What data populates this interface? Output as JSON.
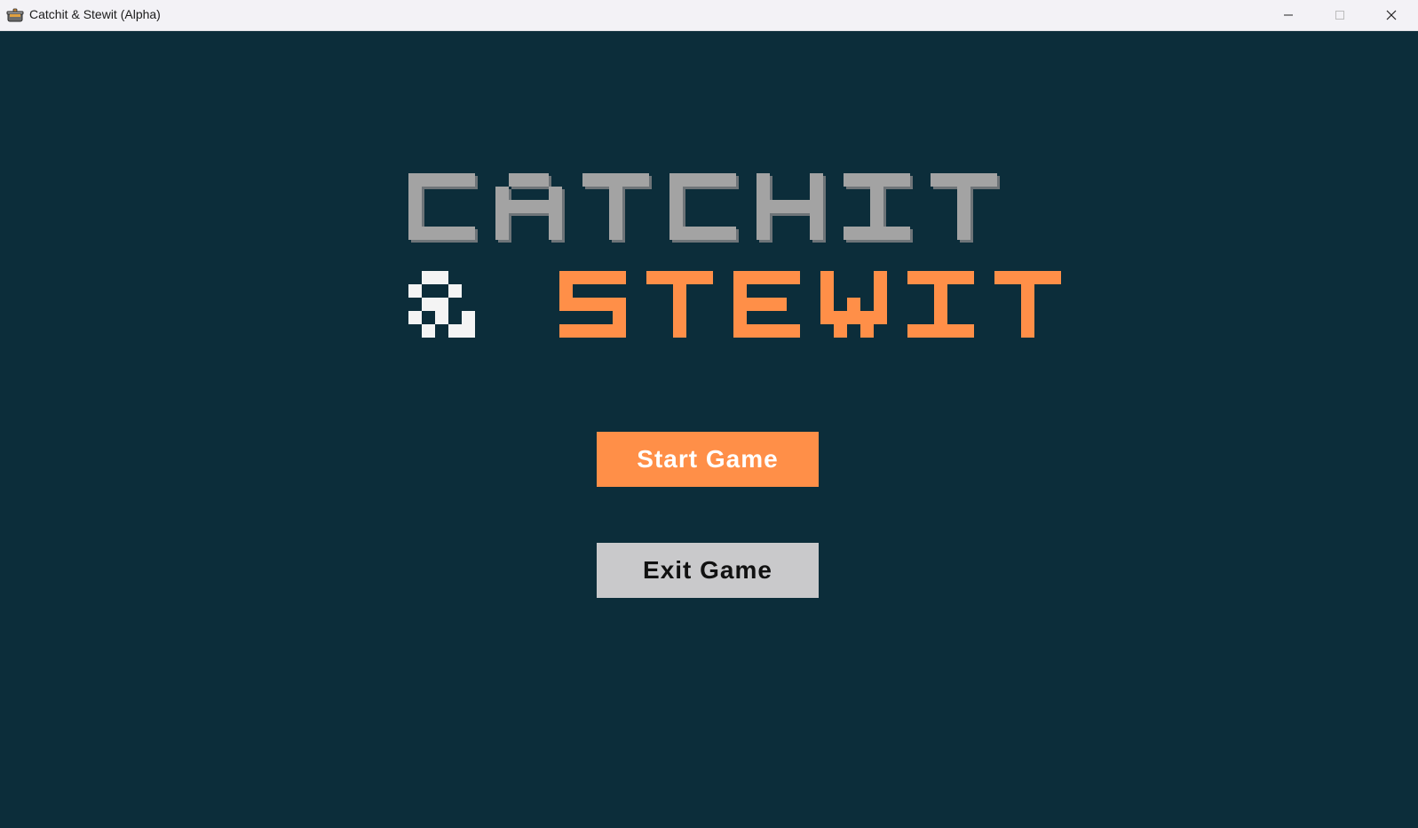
{
  "window": {
    "title": "Catchit & Stewit (Alpha)",
    "icon": "cooking-pot-icon",
    "controls": [
      "minimize-icon",
      "maximize-icon",
      "close-icon"
    ]
  },
  "logo": {
    "line1": "CATCHIT",
    "ampersand": "&",
    "line2": "STEWIT",
    "colors": {
      "line1": "#a3a3a3",
      "line1_shadow": "#6e7478",
      "ampersand": "#f4f4f4",
      "line2": "#ff8f48"
    }
  },
  "menu": {
    "start_label": "Start Game",
    "exit_label": "Exit Game"
  },
  "colors": {
    "background": "#0c2d3a",
    "start_button": "#ff8f48",
    "exit_button": "#c9c9cb"
  }
}
